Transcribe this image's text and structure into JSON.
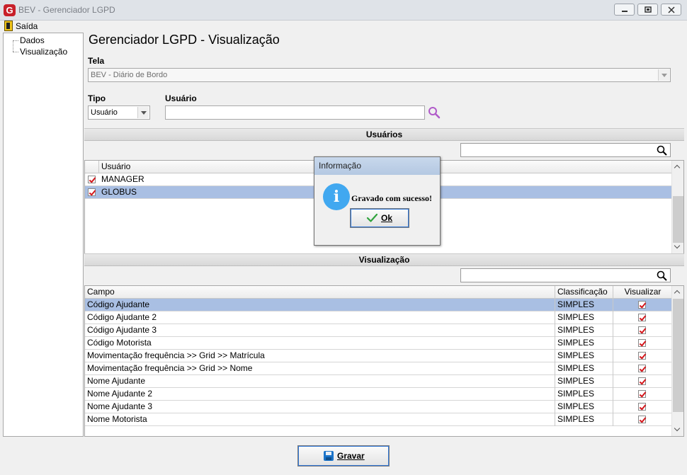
{
  "window": {
    "app_icon": "G",
    "title": "BEV - Gerenciador LGPD",
    "buttons": [
      "minimize-icon",
      "restore-icon",
      "close-icon"
    ]
  },
  "menu": {
    "exit_label": "Saída"
  },
  "tree": {
    "items": [
      {
        "label": "Dados"
      },
      {
        "label": "Visualização"
      }
    ]
  },
  "page": {
    "title": "Gerenciador LGPD - Visualização"
  },
  "form": {
    "tela_label": "Tela",
    "tela_value": "BEV - Diário de Bordo",
    "tipo_label": "Tipo",
    "tipo_value": "Usuário",
    "usuario_label": "Usuário",
    "usuario_value": ""
  },
  "usuarios": {
    "section_title": "Usuários",
    "column_header": "Usuário",
    "rows": [
      {
        "name": "MANAGER",
        "checked": true,
        "selected": false
      },
      {
        "name": "GLOBUS",
        "checked": true,
        "selected": true
      }
    ]
  },
  "visualizacao": {
    "section_title": "Visualização",
    "columns": [
      "Campo",
      "Classificação",
      "Visualizar"
    ],
    "rows": [
      {
        "campo": "Código Ajudante",
        "classificacao": "SIMPLES",
        "visualizar": true,
        "selected": true
      },
      {
        "campo": "Código Ajudante 2",
        "classificacao": "SIMPLES",
        "visualizar": true,
        "selected": false
      },
      {
        "campo": "Código Ajudante 3",
        "classificacao": "SIMPLES",
        "visualizar": true,
        "selected": false
      },
      {
        "campo": "Código Motorista",
        "classificacao": "SIMPLES",
        "visualizar": true,
        "selected": false
      },
      {
        "campo": "Movimentação frequência >> Grid >> Matrícula",
        "classificacao": "SIMPLES",
        "visualizar": true,
        "selected": false
      },
      {
        "campo": "Movimentação frequência >> Grid >> Nome",
        "classificacao": "SIMPLES",
        "visualizar": true,
        "selected": false
      },
      {
        "campo": "Nome Ajudante",
        "classificacao": "SIMPLES",
        "visualizar": true,
        "selected": false
      },
      {
        "campo": "Nome Ajudante 2",
        "classificacao": "SIMPLES",
        "visualizar": true,
        "selected": false
      },
      {
        "campo": "Nome Ajudante 3",
        "classificacao": "SIMPLES",
        "visualizar": true,
        "selected": false
      },
      {
        "campo": "Nome Motorista",
        "classificacao": "SIMPLES",
        "visualizar": true,
        "selected": false
      }
    ]
  },
  "footer": {
    "save_button_label": "Gravar",
    "save_button_icon": "floppy-disk-icon"
  },
  "dialog": {
    "title": "Informação",
    "icon": "info-icon",
    "icon_glyph": "i",
    "message": "Gravado com sucesso!",
    "ok_label": "Ok"
  },
  "colors": {
    "selected_row": "#a9bfe3",
    "check_mark": "#d4161b",
    "info_icon": "#41a8f0",
    "search_icon_purple": "#b05ac9"
  }
}
